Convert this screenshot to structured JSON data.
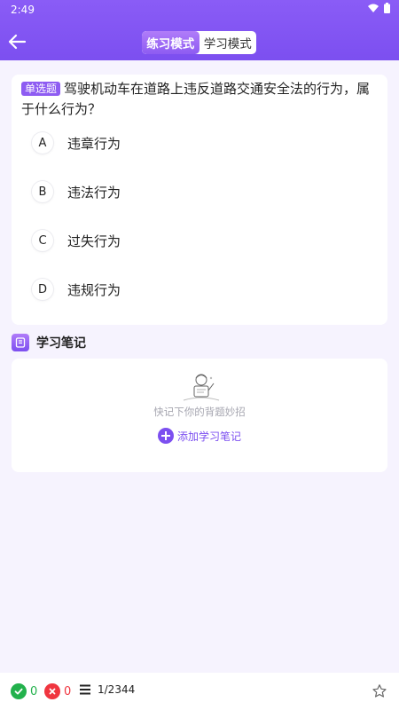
{
  "status_bar": {
    "time": "2:49",
    "icons": [
      "wifi-icon",
      "battery-icon"
    ]
  },
  "header": {
    "back_icon": "arrow-left-icon",
    "modes": [
      {
        "label": "练习模式",
        "active": true
      },
      {
        "label": "学习模式",
        "active": false
      }
    ]
  },
  "question": {
    "type_label": "单选题",
    "text": "驾驶机动车在道路上违反道路交通安全法的行为，属于什么行为？",
    "options": [
      {
        "letter": "A",
        "text": "违章行为"
      },
      {
        "letter": "B",
        "text": "违法行为"
      },
      {
        "letter": "C",
        "text": "过失行为"
      },
      {
        "letter": "D",
        "text": "违规行为"
      }
    ]
  },
  "notes": {
    "title": "学习笔记",
    "hint": "快记下你的背题妙招",
    "add_label": "添加学习笔记"
  },
  "bottom_bar": {
    "correct_count": "0",
    "wrong_count": "0",
    "progress": "1/2344",
    "colors": {
      "correct": "#22b14c",
      "wrong": "#f0353f",
      "accent": "#7c4ff0"
    }
  }
}
